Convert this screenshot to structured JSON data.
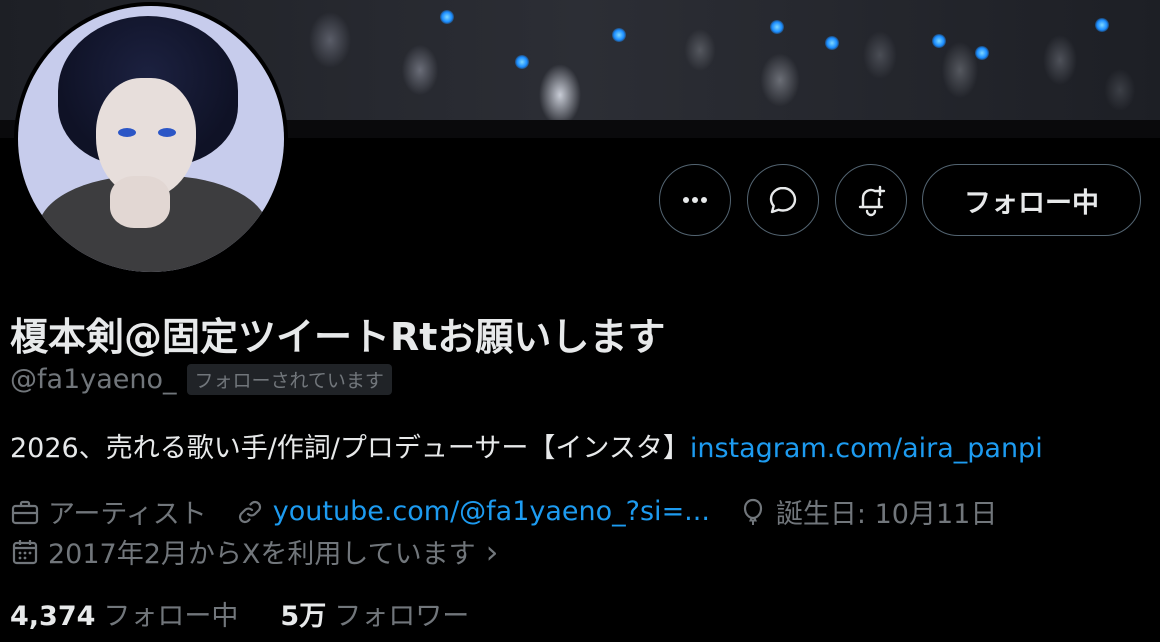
{
  "profile": {
    "display_name": "榎本剣@固定ツイートRtお願いします",
    "handle": "@fa1yaeno_",
    "follows_you_badge": "フォローされています",
    "bio_text": "2026、売れる歌い手/作詞/プロデューサー【インスタ】",
    "bio_link": "instagram.com/aira_panpi",
    "category": "アーティスト",
    "website": "youtube.com/@fa1yaeno_?si=...",
    "birthday": "誕生日: 10月11日",
    "joined": "2017年2月からXを利用しています",
    "joined_chevron": "›"
  },
  "actions": {
    "more_label": "•••",
    "follow_label": "フォロー中"
  },
  "stats": {
    "following_count": "4,374",
    "following_label": "フォロー中",
    "followers_count": "5万",
    "followers_label": "フォロワー"
  },
  "colors": {
    "background": "#000000",
    "text": "#e7e9ea",
    "muted": "#71767b",
    "link": "#1d9bf0",
    "border": "#536471"
  },
  "icons": [
    "more-icon",
    "message-icon",
    "notification-bell-icon",
    "briefcase-icon",
    "link-icon",
    "balloon-icon",
    "calendar-icon"
  ]
}
